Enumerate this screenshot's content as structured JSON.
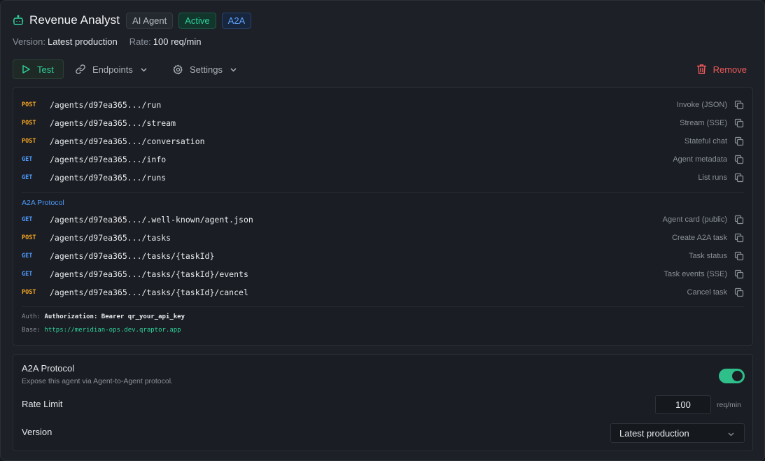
{
  "header": {
    "title": "Revenue Analyst",
    "type_badge": "AI Agent",
    "status_badge": "Active",
    "protocol_badge": "A2A"
  },
  "meta": {
    "version_label": "Version:",
    "version_value": "Latest production",
    "rate_label": "Rate:",
    "rate_value": "100 req/min"
  },
  "toolbar": {
    "test_label": "Test",
    "endpoints_label": "Endpoints",
    "settings_label": "Settings",
    "remove_label": "Remove"
  },
  "endpoints": [
    {
      "method": "POST",
      "path": "/agents/d97ea365.../run",
      "desc": "Invoke (JSON)"
    },
    {
      "method": "POST",
      "path": "/agents/d97ea365.../stream",
      "desc": "Stream (SSE)"
    },
    {
      "method": "POST",
      "path": "/agents/d97ea365.../conversation",
      "desc": "Stateful chat"
    },
    {
      "method": "GET",
      "path": "/agents/d97ea365.../info",
      "desc": "Agent metadata"
    },
    {
      "method": "GET",
      "path": "/agents/d97ea365.../runs",
      "desc": "List runs"
    }
  ],
  "a2a_section_label": "A2A Protocol",
  "a2a_endpoints": [
    {
      "method": "GET",
      "path": "/agents/d97ea365.../.well-known/agent.json",
      "desc": "Agent card (public)"
    },
    {
      "method": "POST",
      "path": "/agents/d97ea365.../tasks",
      "desc": "Create A2A task"
    },
    {
      "method": "GET",
      "path": "/agents/d97ea365.../tasks/{taskId}",
      "desc": "Task status"
    },
    {
      "method": "GET",
      "path": "/agents/d97ea365.../tasks/{taskId}/events",
      "desc": "Task events (SSE)"
    },
    {
      "method": "POST",
      "path": "/agents/d97ea365.../tasks/{taskId}/cancel",
      "desc": "Cancel task"
    }
  ],
  "auth": {
    "auth_label": "Auth:",
    "auth_value": "Authorization: Bearer qr_your_api_key",
    "base_label": "Base:",
    "base_value": "https://meridian-ops.dev.qraptor.app"
  },
  "settings": {
    "a2a_label": "A2A Protocol",
    "a2a_desc": "Expose this agent via Agent-to-Agent protocol.",
    "a2a_enabled": true,
    "rate_label": "Rate Limit",
    "rate_value": "100",
    "rate_unit": "req/min",
    "version_label": "Version",
    "version_value": "Latest production"
  },
  "colors": {
    "accent_green": "#2fd39b",
    "post": "#f5a524",
    "get": "#4f9bff",
    "danger": "#f15a5a"
  }
}
